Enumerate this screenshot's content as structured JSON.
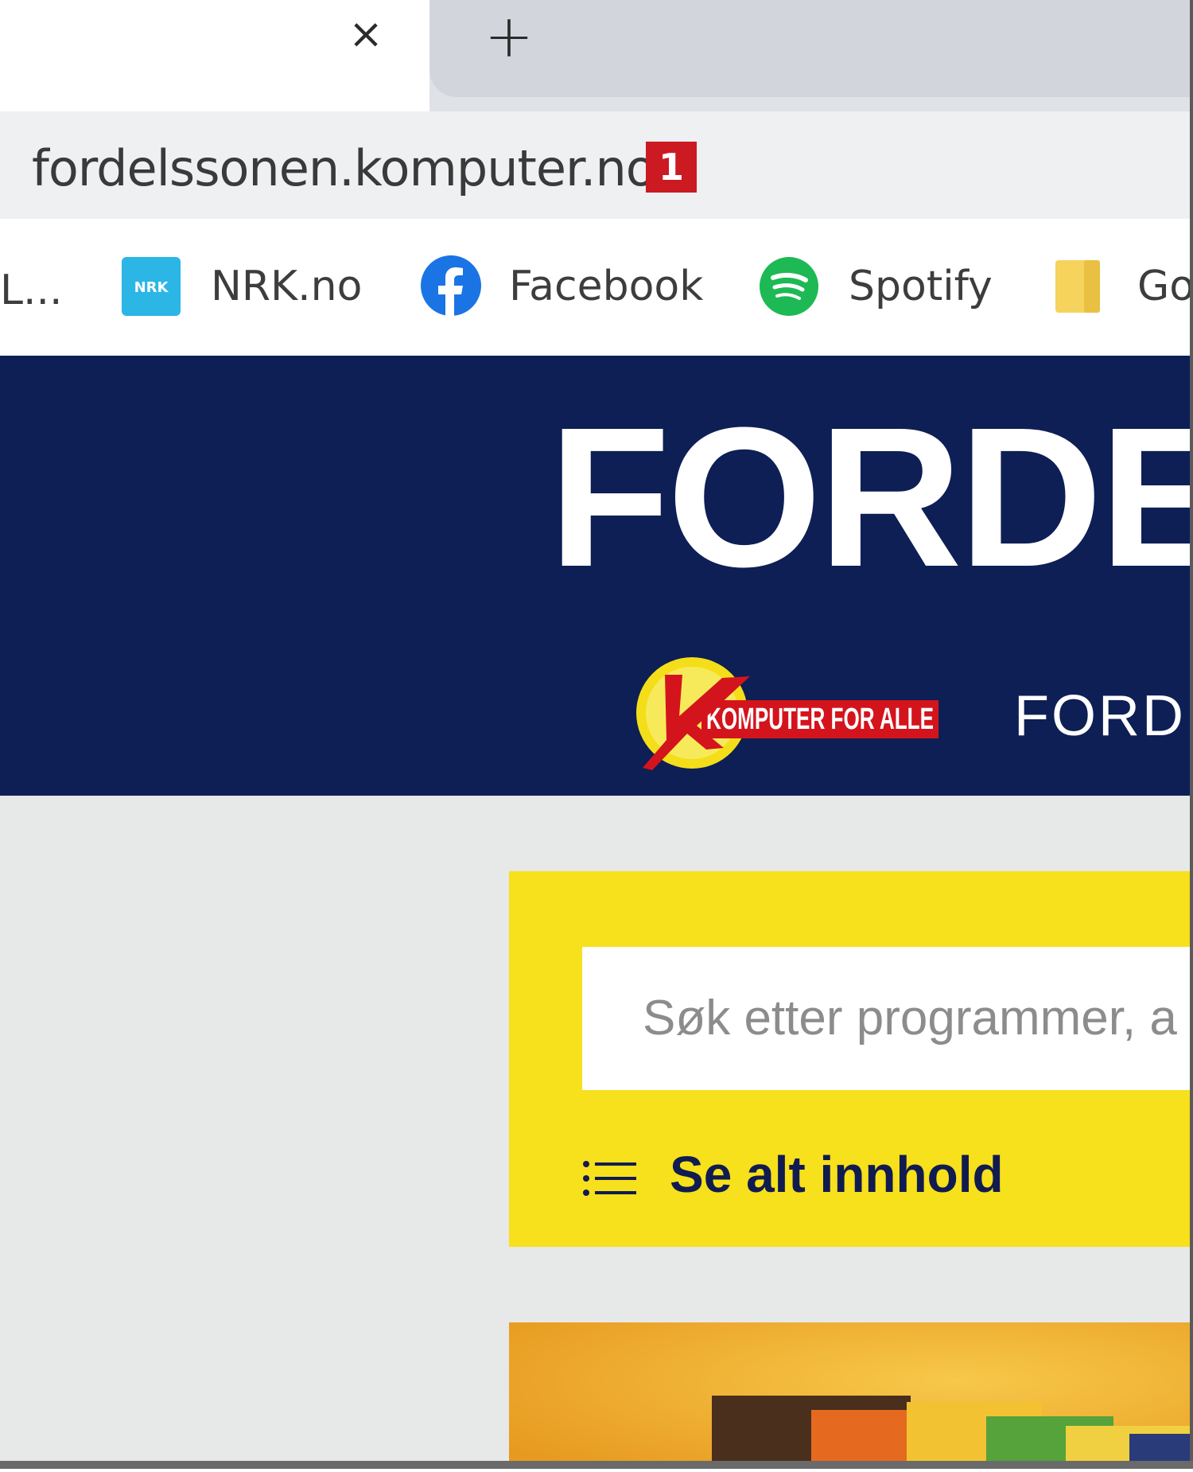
{
  "browser": {
    "tab_close": "×",
    "new_tab": "+",
    "url": "fordelssonen.komputer.no",
    "url_badge": "1",
    "bookmarks": [
      {
        "label": "L...",
        "icon": "truncated-bookmark"
      },
      {
        "label": "NRK.no",
        "icon": "nrk-icon"
      },
      {
        "label": "Facebook",
        "icon": "facebook-icon"
      },
      {
        "label": "Spotify",
        "icon": "spotify-icon"
      },
      {
        "label": "Go",
        "icon": "folder-icon"
      }
    ]
  },
  "site": {
    "title": "FORDE",
    "logo_text": "KOMPUTER FOR ALLE",
    "subnav": "FORD",
    "search_placeholder": "Søk etter programmer, a",
    "see_all": "Se alt innhold",
    "colors": {
      "header": "#0e1f55",
      "accent_yellow": "#f7e01c",
      "logo_red": "#d4141c"
    }
  }
}
